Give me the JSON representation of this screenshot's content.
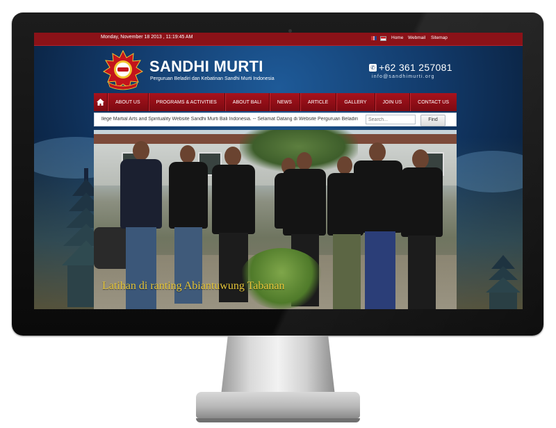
{
  "topbar": {
    "datetime": "Monday, November 18 2013 , 11:19:45 AM",
    "links": [
      "Home",
      "Webmail",
      "Sitemap"
    ]
  },
  "header": {
    "title": "SANDHI MURTI",
    "subtitle": "Perguruan Beladiri dan Kebatinan Sandhi Murti Indonesia",
    "phone": "+62 361 257081",
    "email": "info@sandhimurti.org"
  },
  "nav": {
    "items": [
      "ABOUT US",
      "PROGRAMS & ACTIVITIES",
      "ABOUT BALI",
      "NEWS",
      "ARTICLE",
      "GALLERY",
      "JOIN US",
      "CONTACT US"
    ]
  },
  "ticker": {
    "text": "llege Martial Arts and Spirituality Website Sandhi Murti Bali Indonesia. -- Selamat Datang di Website Perguruan Beladiri dan Ke"
  },
  "search": {
    "placeholder": "Search...",
    "button": "Find"
  },
  "slideshow": {
    "caption": "Latihan di ranting Abiantuwung Tabanan"
  },
  "colors": {
    "nav_red": "#a8121c",
    "topbar_red": "#8b1218",
    "caption_gold": "#e7c73a"
  }
}
